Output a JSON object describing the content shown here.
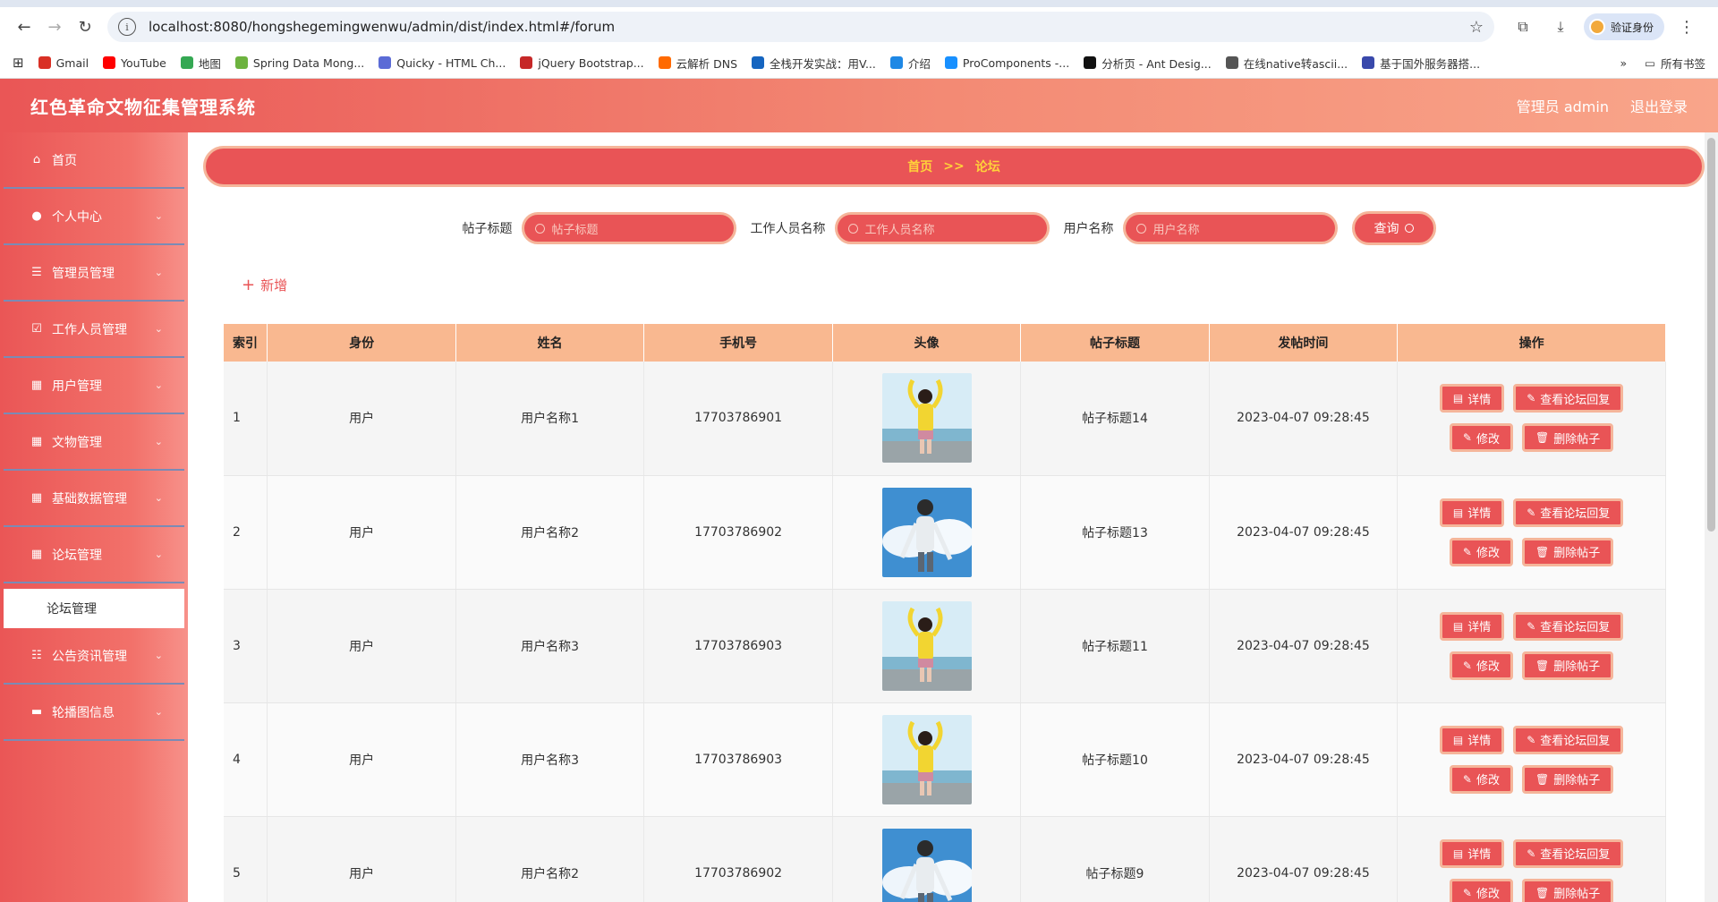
{
  "browser": {
    "url": "localhost:8080/hongshegemingwenwu/admin/dist/index.html#/forum",
    "profile_label": "验证身份",
    "bookmarks": [
      {
        "label": "Gmail",
        "color": "#d93025"
      },
      {
        "label": "YouTube",
        "color": "#ff0000"
      },
      {
        "label": "地图",
        "color": "#34a853"
      },
      {
        "label": "Spring Data Mong...",
        "color": "#6db33f"
      },
      {
        "label": "Quicky - HTML Ch...",
        "color": "#5b6bd6"
      },
      {
        "label": "jQuery Bootstrap...",
        "color": "#c62828"
      },
      {
        "label": "云解析 DNS",
        "color": "#ff6a00"
      },
      {
        "label": "全栈开发实战：用V...",
        "color": "#1565c0"
      },
      {
        "label": "介绍",
        "color": "#1e88e5"
      },
      {
        "label": "ProComponents -...",
        "color": "#1890ff"
      },
      {
        "label": "分析页 - Ant Desig...",
        "color": "#111111"
      },
      {
        "label": "在线native转ascii...",
        "color": "#555555"
      },
      {
        "label": "基于国外服务器搭...",
        "color": "#3949ab"
      }
    ],
    "all_bookmarks": "所有书签"
  },
  "header": {
    "title": "红色革命文物征集管理系统",
    "admin_label": "管理员 admin",
    "logout_label": "退出登录"
  },
  "sidebar": {
    "items": [
      {
        "label": "首页",
        "icon": "home-icon",
        "glyph": "⌂",
        "chevron": false
      },
      {
        "label": "个人中心",
        "icon": "user-icon",
        "glyph": "●",
        "chevron": true
      },
      {
        "label": "管理员管理",
        "icon": "menu-icon",
        "glyph": "☰",
        "chevron": true
      },
      {
        "label": "工作人员管理",
        "icon": "checkbox-icon",
        "glyph": "☑",
        "chevron": true
      },
      {
        "label": "用户管理",
        "icon": "grid-icon",
        "glyph": "▦",
        "chevron": true
      },
      {
        "label": "文物管理",
        "icon": "grid-icon",
        "glyph": "▦",
        "chevron": true
      },
      {
        "label": "基础数据管理",
        "icon": "grid-icon",
        "glyph": "▦",
        "chevron": true
      },
      {
        "label": "论坛管理",
        "icon": "grid-icon",
        "glyph": "▦",
        "chevron": true
      }
    ],
    "active_sub": "论坛管理",
    "items_after": [
      {
        "label": "公告资讯管理",
        "icon": "sliders-icon",
        "glyph": "☷",
        "chevron": true
      },
      {
        "label": "轮播图信息",
        "icon": "monitor-icon",
        "glyph": "▬",
        "chevron": true
      }
    ]
  },
  "breadcrumb": {
    "home": "首页",
    "sep": ">>",
    "current": "论坛"
  },
  "search": {
    "title_label": "帖子标题",
    "title_placeholder": "帖子标题",
    "staff_label": "工作人员名称",
    "staff_placeholder": "工作人员名称",
    "user_label": "用户名称",
    "user_placeholder": "用户名称",
    "button": "查询"
  },
  "add_label": "新增",
  "table": {
    "columns": [
      "索引",
      "身份",
      "姓名",
      "手机号",
      "头像",
      "帖子标题",
      "发帖时间",
      "操作"
    ],
    "rows": [
      {
        "idx": "1",
        "role": "用户",
        "name": "用户名称1",
        "phone": "17703786901",
        "avatar": "girl-yellow",
        "title": "帖子标题14",
        "time": "2023-04-07 09:28:45"
      },
      {
        "idx": "2",
        "role": "用户",
        "name": "用户名称2",
        "phone": "17703786902",
        "avatar": "boy-sky",
        "title": "帖子标题13",
        "time": "2023-04-07 09:28:45"
      },
      {
        "idx": "3",
        "role": "用户",
        "name": "用户名称3",
        "phone": "17703786903",
        "avatar": "girl-yellow",
        "title": "帖子标题11",
        "time": "2023-04-07 09:28:45"
      },
      {
        "idx": "4",
        "role": "用户",
        "name": "用户名称3",
        "phone": "17703786903",
        "avatar": "girl-yellow",
        "title": "帖子标题10",
        "time": "2023-04-07 09:28:45"
      },
      {
        "idx": "5",
        "role": "用户",
        "name": "用户名称2",
        "phone": "17703786902",
        "avatar": "boy-sky",
        "title": "帖子标题9",
        "time": "2023-04-07 09:28:45"
      }
    ],
    "actions": {
      "detail": "详情",
      "replies": "查看论坛回复",
      "edit": "修改",
      "delete": "删除帖子"
    }
  },
  "colors": {
    "primary": "#e95456",
    "border": "#f5b59a",
    "header_row": "#f9b890",
    "breadcrumb_text": "#ffd23a"
  }
}
